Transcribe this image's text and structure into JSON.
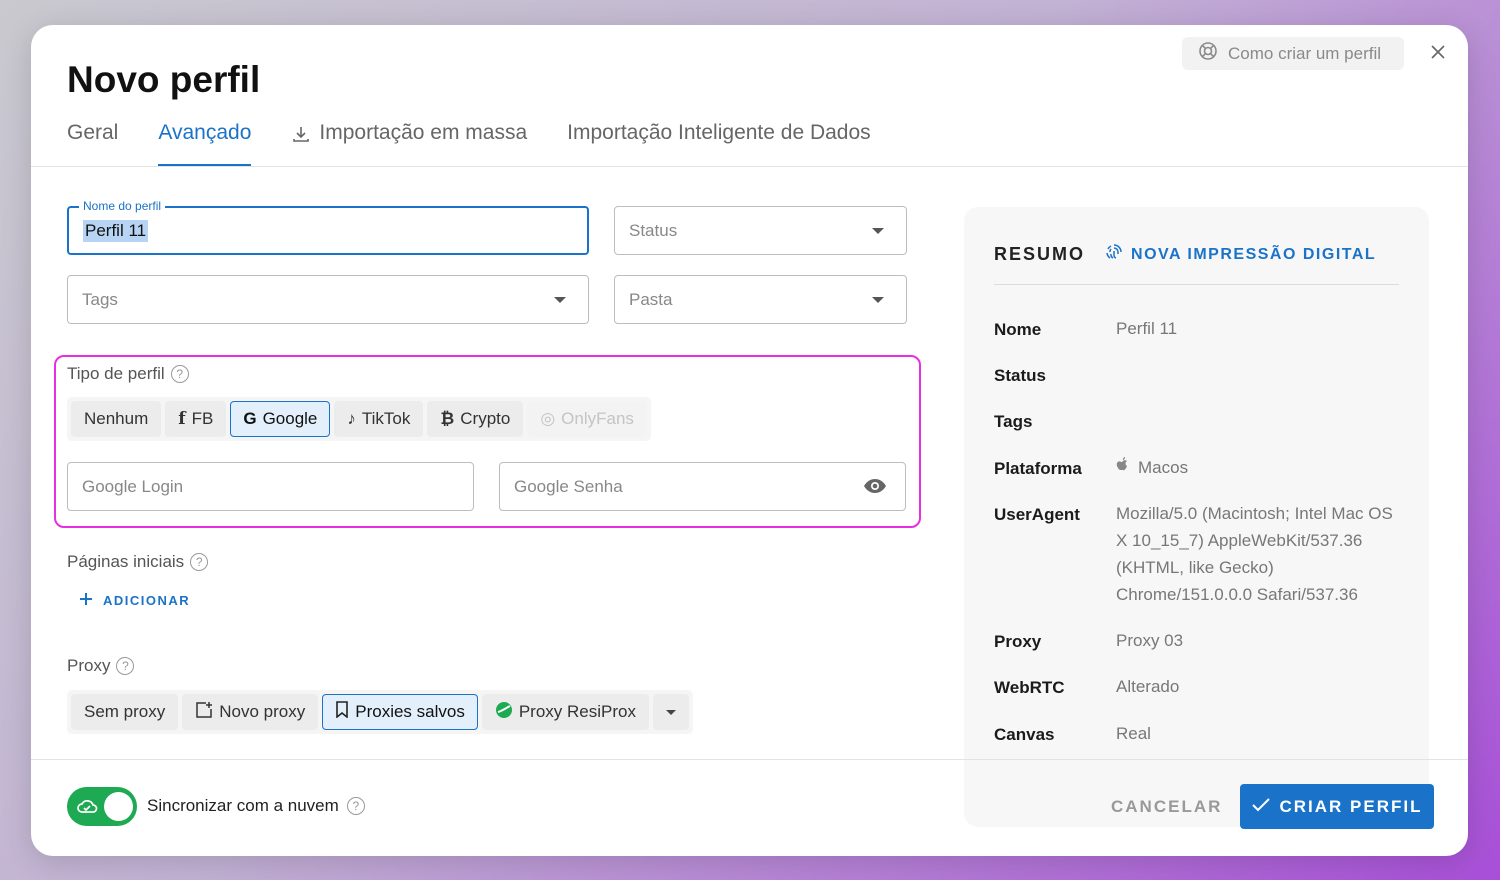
{
  "dialog": {
    "title": "Novo perfil",
    "help_link": "Como criar um perfil"
  },
  "tabs": [
    {
      "label": "Geral"
    },
    {
      "label": "Avançado"
    },
    {
      "label": "Importação em massa"
    },
    {
      "label": "Importação Inteligente de Dados"
    }
  ],
  "form": {
    "profile_name": {
      "label": "Nome do perfil",
      "value": "Perfil 11"
    },
    "status": {
      "placeholder": "Status"
    },
    "tags": {
      "placeholder": "Tags"
    },
    "folder": {
      "placeholder": "Pasta"
    },
    "profile_type": {
      "label": "Tipo de perfil",
      "options": [
        "Nenhum",
        "FB",
        "Google",
        "TikTok",
        "Crypto",
        "OnlyFans"
      ],
      "selected": "Google"
    },
    "google_login": {
      "placeholder": "Google Login"
    },
    "google_password": {
      "placeholder": "Google Senha"
    },
    "start_pages": {
      "label": "Páginas iniciais",
      "add_label": "ADICIONAR"
    },
    "proxy": {
      "label": "Proxy",
      "options": [
        "Sem proxy",
        "Novo proxy",
        "Proxies salvos",
        "Proxy ResiProx"
      ],
      "selected": "Proxies salvos"
    }
  },
  "summary": {
    "title": "RESUMO",
    "fingerprint_link": "NOVA IMPRESSÃO DIGITAL",
    "rows": {
      "name": {
        "key": "Nome",
        "value": "Perfil 11"
      },
      "status": {
        "key": "Status",
        "value": ""
      },
      "tags": {
        "key": "Tags",
        "value": ""
      },
      "platform": {
        "key": "Plataforma",
        "value": "Macos"
      },
      "useragent": {
        "key": "UserAgent",
        "value": "Mozilla/5.0 (Macintosh; Intel Mac OS X 10_15_7) AppleWebKit/537.36 (KHTML, like Gecko) Chrome/151.0.0.0 Safari/537.36"
      },
      "proxy": {
        "key": "Proxy",
        "value": "Proxy 03"
      },
      "webrtc": {
        "key": "WebRTC",
        "value": "Alterado"
      },
      "canvas": {
        "key": "Canvas",
        "value": "Real"
      }
    }
  },
  "footer": {
    "sync_label": "Sincronizar com a nuvem",
    "sync_enabled": true,
    "cancel_label": "CANCELAR",
    "create_label": "CRIAR PERFIL"
  },
  "colors": {
    "accent": "#1a73c8",
    "highlight": "#e62fe0",
    "toggle_on": "#1ea953"
  }
}
